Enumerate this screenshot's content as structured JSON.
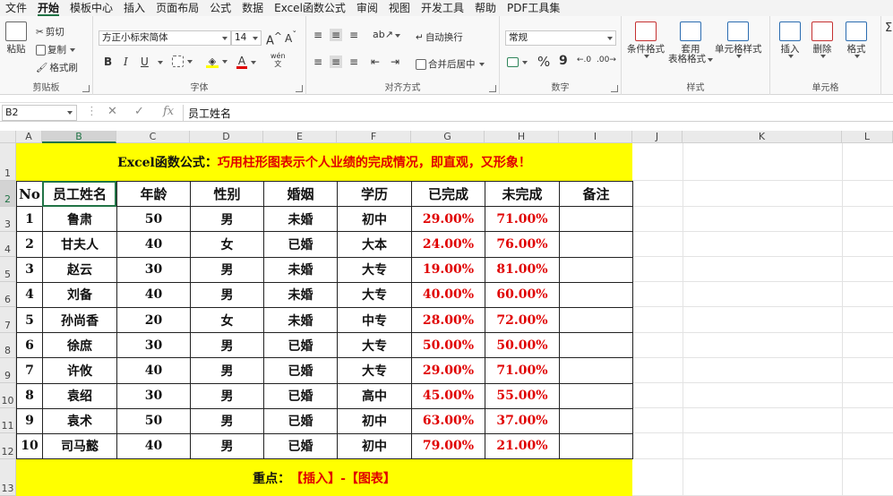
{
  "menu": [
    "文件",
    "开始",
    "模板中心",
    "插入",
    "页面布局",
    "公式",
    "数据",
    "Excel函数公式",
    "审阅",
    "视图",
    "开发工具",
    "帮助",
    "PDF工具集"
  ],
  "menu_active_index": 1,
  "ribbon": {
    "clipboard": {
      "paste": "粘贴",
      "cut": "剪切",
      "copy": "复制",
      "format_painter": "格式刷",
      "label": "剪贴板"
    },
    "font": {
      "name": "方正小标宋简体",
      "size": "14",
      "grow": "A",
      "shrink": "A",
      "bold": "B",
      "italic": "I",
      "underline": "U",
      "wen": "wén",
      "wen_sub": "文",
      "label": "字体"
    },
    "alignment": {
      "wrap": "自动换行",
      "merge": "合并后居中",
      "label": "对齐方式"
    },
    "number": {
      "format": "常规",
      "percent": "%",
      "comma": "9",
      "label": "数字"
    },
    "styles": {
      "conditional": "条件格式",
      "table_format_1": "套用",
      "table_format_2": "表格格式",
      "cell_styles": "单元格样式",
      "label": "样式"
    },
    "cells": {
      "insert": "插入",
      "delete": "删除",
      "format": "格式",
      "label": "单元格"
    }
  },
  "formula_bar": {
    "name_box": "B2",
    "fx": "fx",
    "cancel": "✕",
    "enter": "✓",
    "value": "员工姓名"
  },
  "columns": [
    "A",
    "B",
    "C",
    "D",
    "E",
    "F",
    "G",
    "H",
    "I",
    "J",
    "K",
    "L"
  ],
  "rows": [
    "1",
    "2",
    "3",
    "4",
    "5",
    "6",
    "7",
    "8",
    "9",
    "10",
    "11",
    "12",
    "13"
  ],
  "sheet": {
    "title_black": "Excel函数公式：",
    "title_red": "巧用柱形图表示个人业绩的完成情况，即直观，又形象！",
    "headers": [
      "No",
      "员工姓名",
      "年龄",
      "性别",
      "婚姻",
      "学历",
      "已完成",
      "未完成",
      "备注"
    ],
    "data": [
      [
        "1",
        "鲁肃",
        "50",
        "男",
        "未婚",
        "初中",
        "29.00%",
        "71.00%",
        ""
      ],
      [
        "2",
        "甘夫人",
        "40",
        "女",
        "已婚",
        "大本",
        "24.00%",
        "76.00%",
        ""
      ],
      [
        "3",
        "赵云",
        "30",
        "男",
        "未婚",
        "大专",
        "19.00%",
        "81.00%",
        ""
      ],
      [
        "4",
        "刘备",
        "40",
        "男",
        "未婚",
        "大专",
        "40.00%",
        "60.00%",
        ""
      ],
      [
        "5",
        "孙尚香",
        "20",
        "女",
        "未婚",
        "中专",
        "28.00%",
        "72.00%",
        ""
      ],
      [
        "6",
        "徐庶",
        "30",
        "男",
        "已婚",
        "大专",
        "50.00%",
        "50.00%",
        ""
      ],
      [
        "7",
        "许攸",
        "40",
        "男",
        "已婚",
        "大专",
        "29.00%",
        "71.00%",
        ""
      ],
      [
        "8",
        "袁绍",
        "30",
        "男",
        "已婚",
        "高中",
        "45.00%",
        "55.00%",
        ""
      ],
      [
        "9",
        "袁术",
        "50",
        "男",
        "已婚",
        "初中",
        "63.00%",
        "37.00%",
        ""
      ],
      [
        "10",
        "司马懿",
        "40",
        "男",
        "已婚",
        "初中",
        "79.00%",
        "21.00%",
        ""
      ]
    ],
    "footer_black": "重点：",
    "footer_red": "【插入】-【图表】"
  },
  "colors": {
    "band": "#ffff00",
    "red_text": "#e00000",
    "accent": "#217346"
  }
}
